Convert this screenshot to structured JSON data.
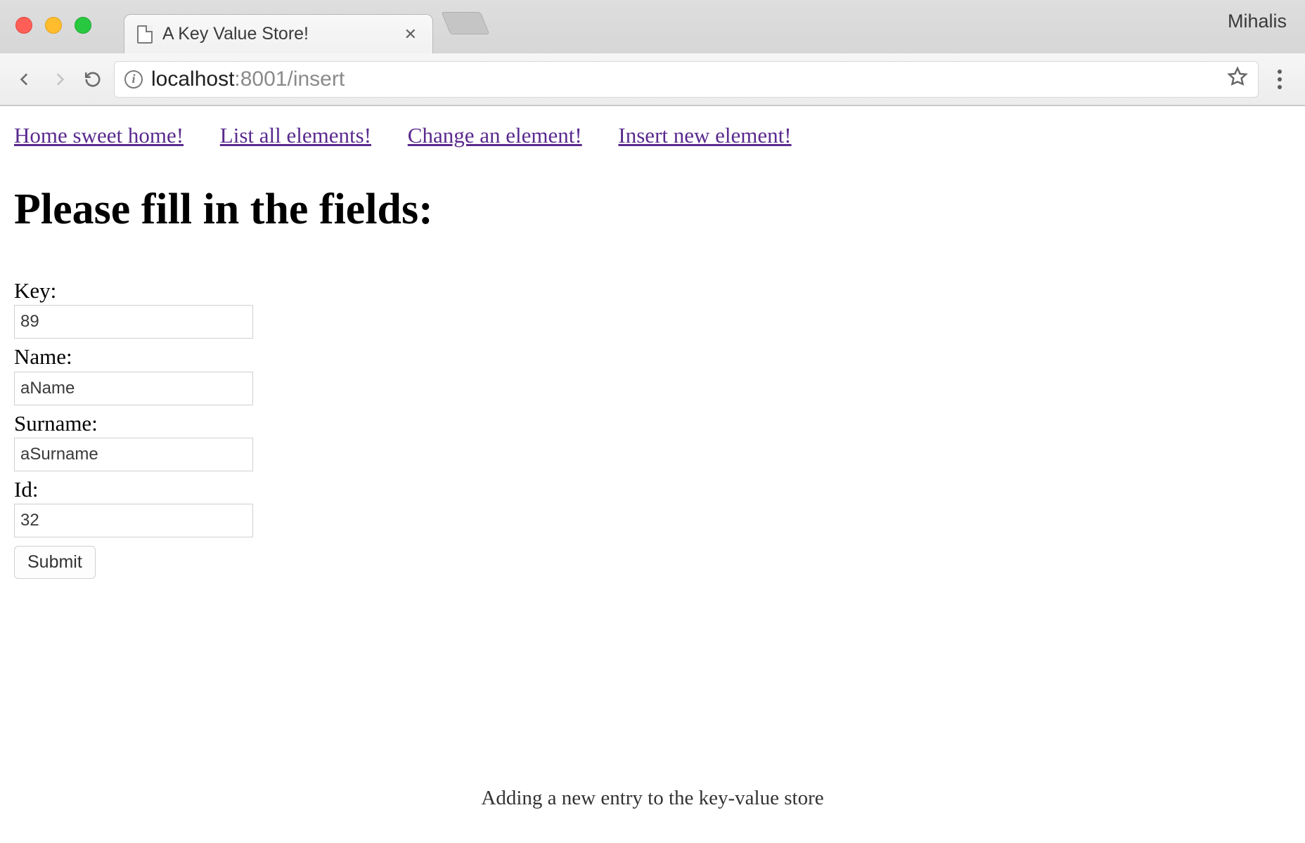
{
  "browser": {
    "tab_title": "A Key Value Store!",
    "profile_name": "Mihalis",
    "url_host": "localhost",
    "url_rest": ":8001/insert"
  },
  "nav": {
    "home": "Home sweet home!",
    "list": "List all elements!",
    "change": "Change an element!",
    "insert": "Insert new element!"
  },
  "page": {
    "heading": "Please fill in the fields:",
    "labels": {
      "key": "Key:",
      "name": "Name:",
      "surname": "Surname:",
      "id": "Id:"
    },
    "values": {
      "key": "89",
      "name": "aName",
      "surname": "aSurname",
      "id": "32"
    },
    "submit": "Submit"
  },
  "caption": "Adding a new entry to the key-value store"
}
